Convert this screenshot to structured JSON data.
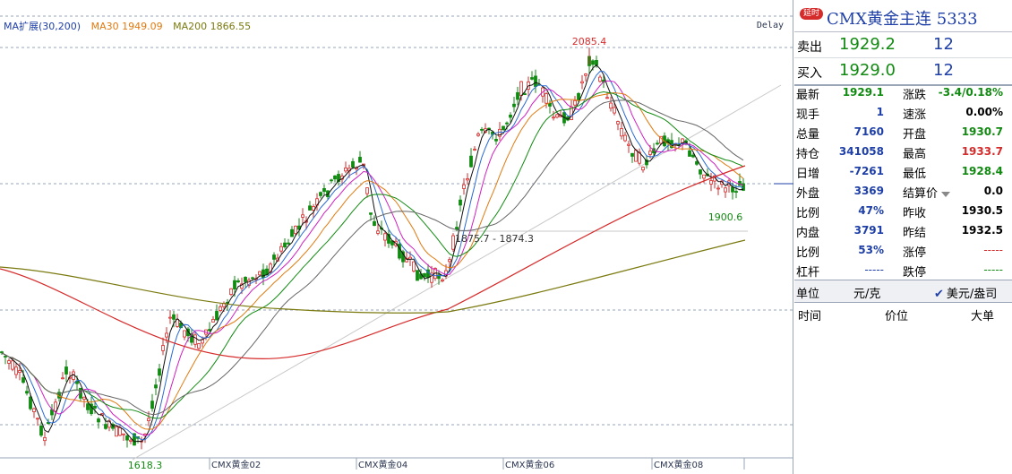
{
  "chart": {
    "ma_legend": [
      {
        "text": "MA扩展(30,200)",
        "color": "#1e3fa8"
      },
      {
        "text": "MA30 1949.09",
        "color": "#e07a10"
      },
      {
        "text": "MA200 1866.55",
        "color": "#7a7a10"
      }
    ],
    "delay_label": "Delay",
    "annotations": {
      "high": "2085.4",
      "low": "1618.3",
      "recent_low": "1900.6",
      "range": "1875.7 - 1874.3"
    },
    "x_labels": [
      "CMX黄金02",
      "CMX黄金04",
      "CMX黄金06",
      "CMX黄金08"
    ],
    "colors": {
      "up": "#d62b2b",
      "down": "#118a11",
      "grid": "#9aa5b8"
    }
  },
  "panel": {
    "badge": "延时",
    "title": "CMX黄金主连  5333",
    "sell": {
      "label": "卖出",
      "price": "1929.2",
      "volume": "12"
    },
    "buy": {
      "label": "买入",
      "price": "1929.0",
      "volume": "12"
    },
    "stats": [
      {
        "l1": "最新",
        "v1": "1929.1",
        "c1": "green",
        "l2": "涨跌",
        "v2": "-3.4/0.18%",
        "c2": "green"
      },
      {
        "l1": "现手",
        "v1": "1",
        "c1": "blue",
        "l2": "速涨",
        "v2": "0.00%",
        "c2": "black"
      },
      {
        "l1": "总量",
        "v1": "7160",
        "c1": "blue",
        "l2": "开盘",
        "v2": "1930.7",
        "c2": "green"
      },
      {
        "l1": "持仓",
        "v1": "341058",
        "c1": "blue",
        "l2": "最高",
        "v2": "1933.7",
        "c2": "red"
      },
      {
        "l1": "日增",
        "v1": "-7261",
        "c1": "blue",
        "l2": "最低",
        "v2": "1928.4",
        "c2": "green"
      },
      {
        "l1": "外盘",
        "v1": "3369",
        "c1": "blue",
        "l2": "结算价",
        "v2": "0.0",
        "c2": "black"
      },
      {
        "l1": "比例",
        "v1": "47%",
        "c1": "blue",
        "l2": "昨收",
        "v2": "1930.5",
        "c2": "black"
      },
      {
        "l1": "内盘",
        "v1": "3791",
        "c1": "blue",
        "l2": "昨结",
        "v2": "1932.5",
        "c2": "black"
      },
      {
        "l1": "比例",
        "v1": "53%",
        "c1": "blue",
        "l2": "涨停",
        "v2": "-----",
        "c2": "red"
      },
      {
        "l1": "杠杆",
        "v1": "-----",
        "c1": "blue",
        "l2": "跌停",
        "v2": "-----",
        "c2": "green"
      }
    ],
    "unit": {
      "label": "单位",
      "value": "元/克",
      "option": "美元/盎司"
    },
    "tick_headers": [
      "时间",
      "价位",
      "大单"
    ]
  }
}
